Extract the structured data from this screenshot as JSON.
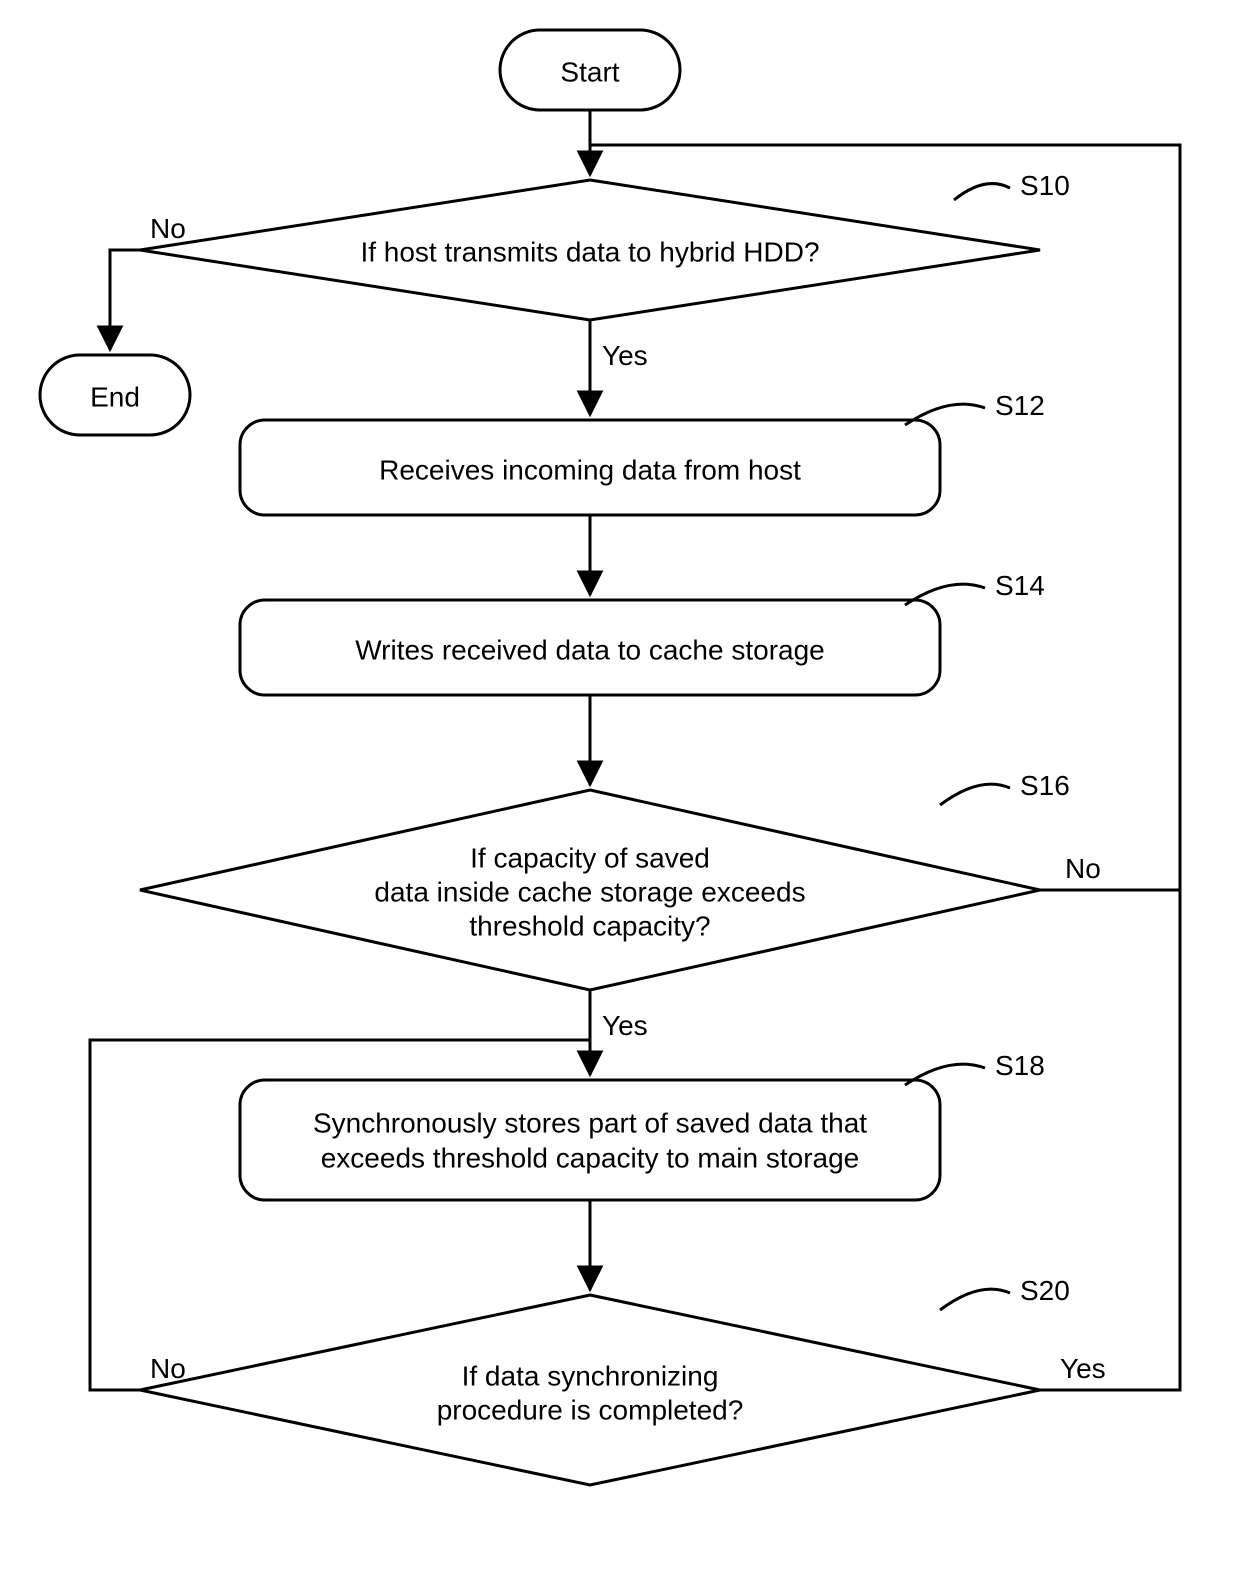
{
  "nodes": {
    "start": {
      "text": "Start",
      "tag": ""
    },
    "end": {
      "text": "End",
      "tag": ""
    },
    "s10": {
      "line1": "If host transmits data to hybrid HDD?",
      "tag": "S10"
    },
    "s12": {
      "line1": "Receives incoming data from host",
      "tag": "S12"
    },
    "s14": {
      "line1": "Writes received data to cache storage",
      "tag": "S14"
    },
    "s16": {
      "line1": "If capacity of saved",
      "line2": "data inside cache storage exceeds",
      "line3": "threshold capacity?",
      "tag": "S16"
    },
    "s18": {
      "line1": "Synchronously stores part of saved data that",
      "line2": "exceeds threshold capacity to main storage",
      "tag": "S18"
    },
    "s20": {
      "line1": "If data synchronizing",
      "line2": "procedure is completed?",
      "tag": "S20"
    }
  },
  "edges": {
    "yes": "Yes",
    "no": "No"
  }
}
